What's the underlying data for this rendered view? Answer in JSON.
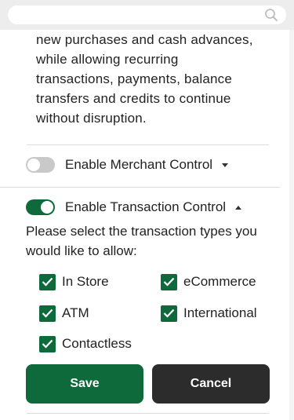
{
  "search": {
    "placeholder": ""
  },
  "description_lines": [
    "new purchases and cash advances,",
    "while allowing recurring",
    "transactions, payments, balance",
    "transfers and credits to continue",
    "without disruption."
  ],
  "merchant_control": {
    "label": "Enable Merchant Control",
    "enabled": false
  },
  "transaction_control": {
    "label": "Enable Transaction Control",
    "enabled": true
  },
  "prompt_lines": [
    "Please select the transaction types you",
    "would like to allow:"
  ],
  "transaction_types": [
    {
      "label": "In Store",
      "checked": true
    },
    {
      "label": "eCommerce",
      "checked": true
    },
    {
      "label": "ATM",
      "checked": true
    },
    {
      "label": "International",
      "checked": true
    },
    {
      "label": "Contactless",
      "checked": true
    }
  ],
  "buttons": {
    "save": "Save",
    "cancel": "Cancel"
  },
  "colors": {
    "accent": "#0e6a3b",
    "cancel": "#2c2c2c",
    "toggle_off": "#c9c9c9"
  }
}
